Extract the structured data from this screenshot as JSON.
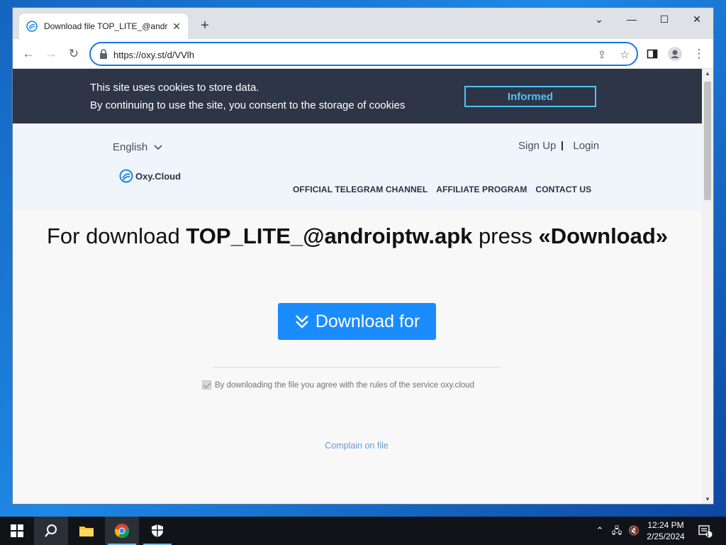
{
  "browser": {
    "tab_title": "Download file TOP_LITE_@andro",
    "new_tab_label": "+",
    "url": "https://oxy.st/d/VVlh"
  },
  "cookie": {
    "line1": "This site uses cookies to store data.",
    "line2": "By continuing to use the site, you consent to the storage of cookies",
    "button": "Informed"
  },
  "header": {
    "language": "English",
    "sign_up": "Sign Up",
    "login": "Login",
    "logo_text": "Oxy.Cloud",
    "nav": [
      "OFFICIAL TELEGRAM CHANNEL",
      "AFFILIATE PROGRAM",
      "CONTACT US"
    ]
  },
  "main": {
    "headline_prefix": "For download ",
    "file_name": "TOP_LITE_@androiptw.apk",
    "headline_mid": " press ",
    "headline_action": "«Download»",
    "download_button": "Download for",
    "agree_text": "By downloading the file you agree with the rules of the service oxy.cloud",
    "complain": "Complain on file"
  },
  "taskbar": {
    "time": "12:24 PM",
    "date": "2/25/2024",
    "notification_count": "1"
  },
  "colors": {
    "cookie_bg": "#2e3547",
    "accent": "#1a8cff",
    "informed": "#4fc3f7"
  }
}
